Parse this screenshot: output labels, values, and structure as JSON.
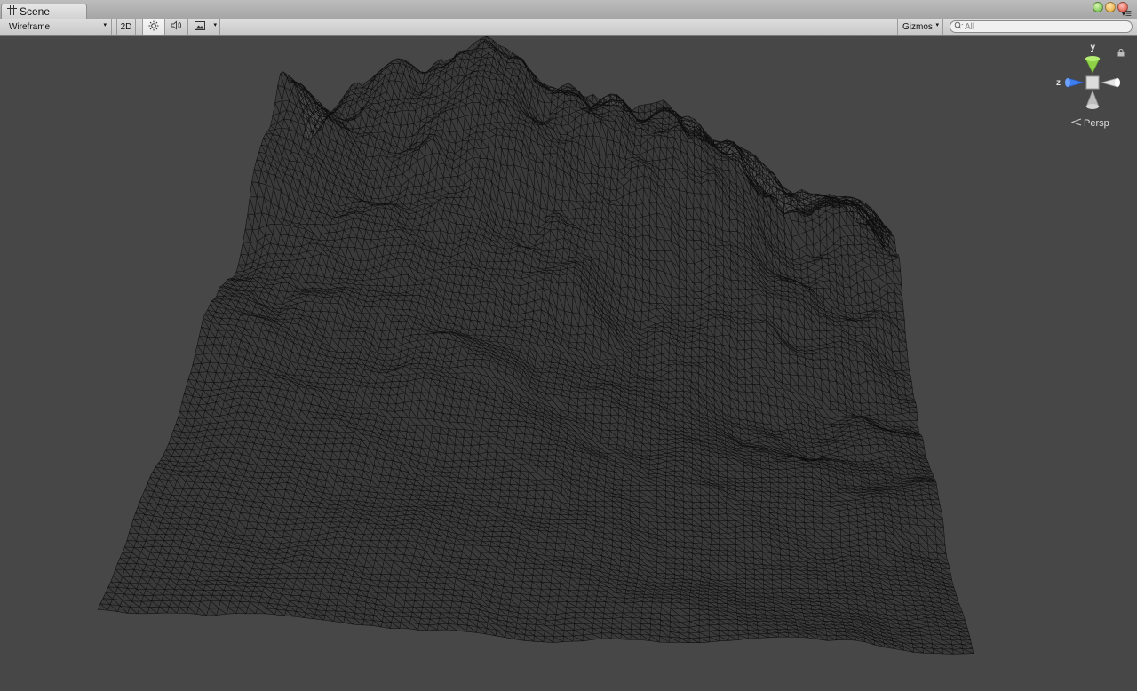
{
  "window": {
    "tab_label": "Scene",
    "tab_icon": "scene-grid-icon"
  },
  "toolbar": {
    "draw_mode": "Wireframe",
    "mode_2d_label": "2D",
    "lighting_icon": "sun-icon",
    "audio_icon": "speaker-icon",
    "effects_icon": "image-icon",
    "gizmos_label": "Gizmos",
    "search_placeholder": "All"
  },
  "scene_gizmo": {
    "y_label": "y",
    "z_label": "z",
    "projection_label": "Persp",
    "colors": {
      "y": "#8fd24a",
      "z": "#3f7ef0",
      "x_neg": "#e8e8e8"
    }
  },
  "colors": {
    "viewport_bg": "#474747",
    "wire": "#0d0d0d",
    "terrain_fill": "#3a3a3a"
  }
}
